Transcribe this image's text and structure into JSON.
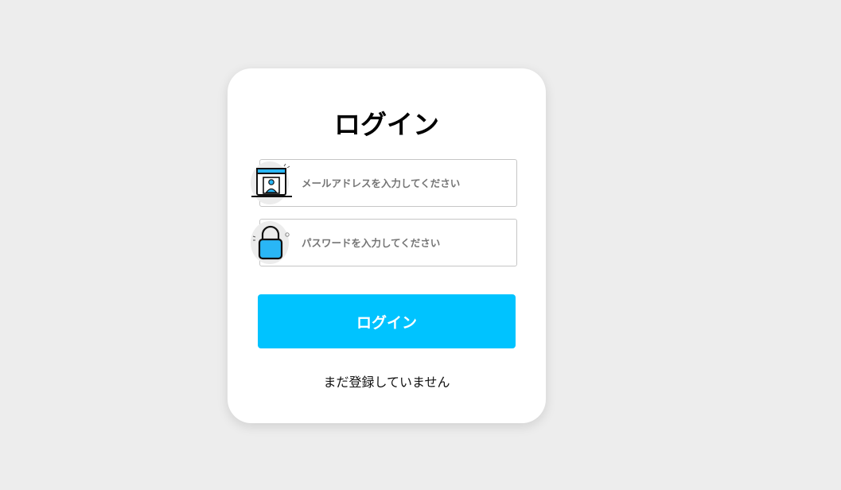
{
  "login_card": {
    "title": "ログイン",
    "email": {
      "placeholder": "メールアドレスを入力してください",
      "value": "",
      "icon": "user-profile-screen-icon"
    },
    "password": {
      "placeholder": "パスワードを入力してください",
      "value": "",
      "icon": "padlock-icon"
    },
    "submit_label": "ログイン",
    "register_link": "まだ登録していません"
  },
  "colors": {
    "background": "#ededed",
    "card": "#ffffff",
    "accent": "#00c3ff",
    "icon_fill": "#29b6f6"
  }
}
